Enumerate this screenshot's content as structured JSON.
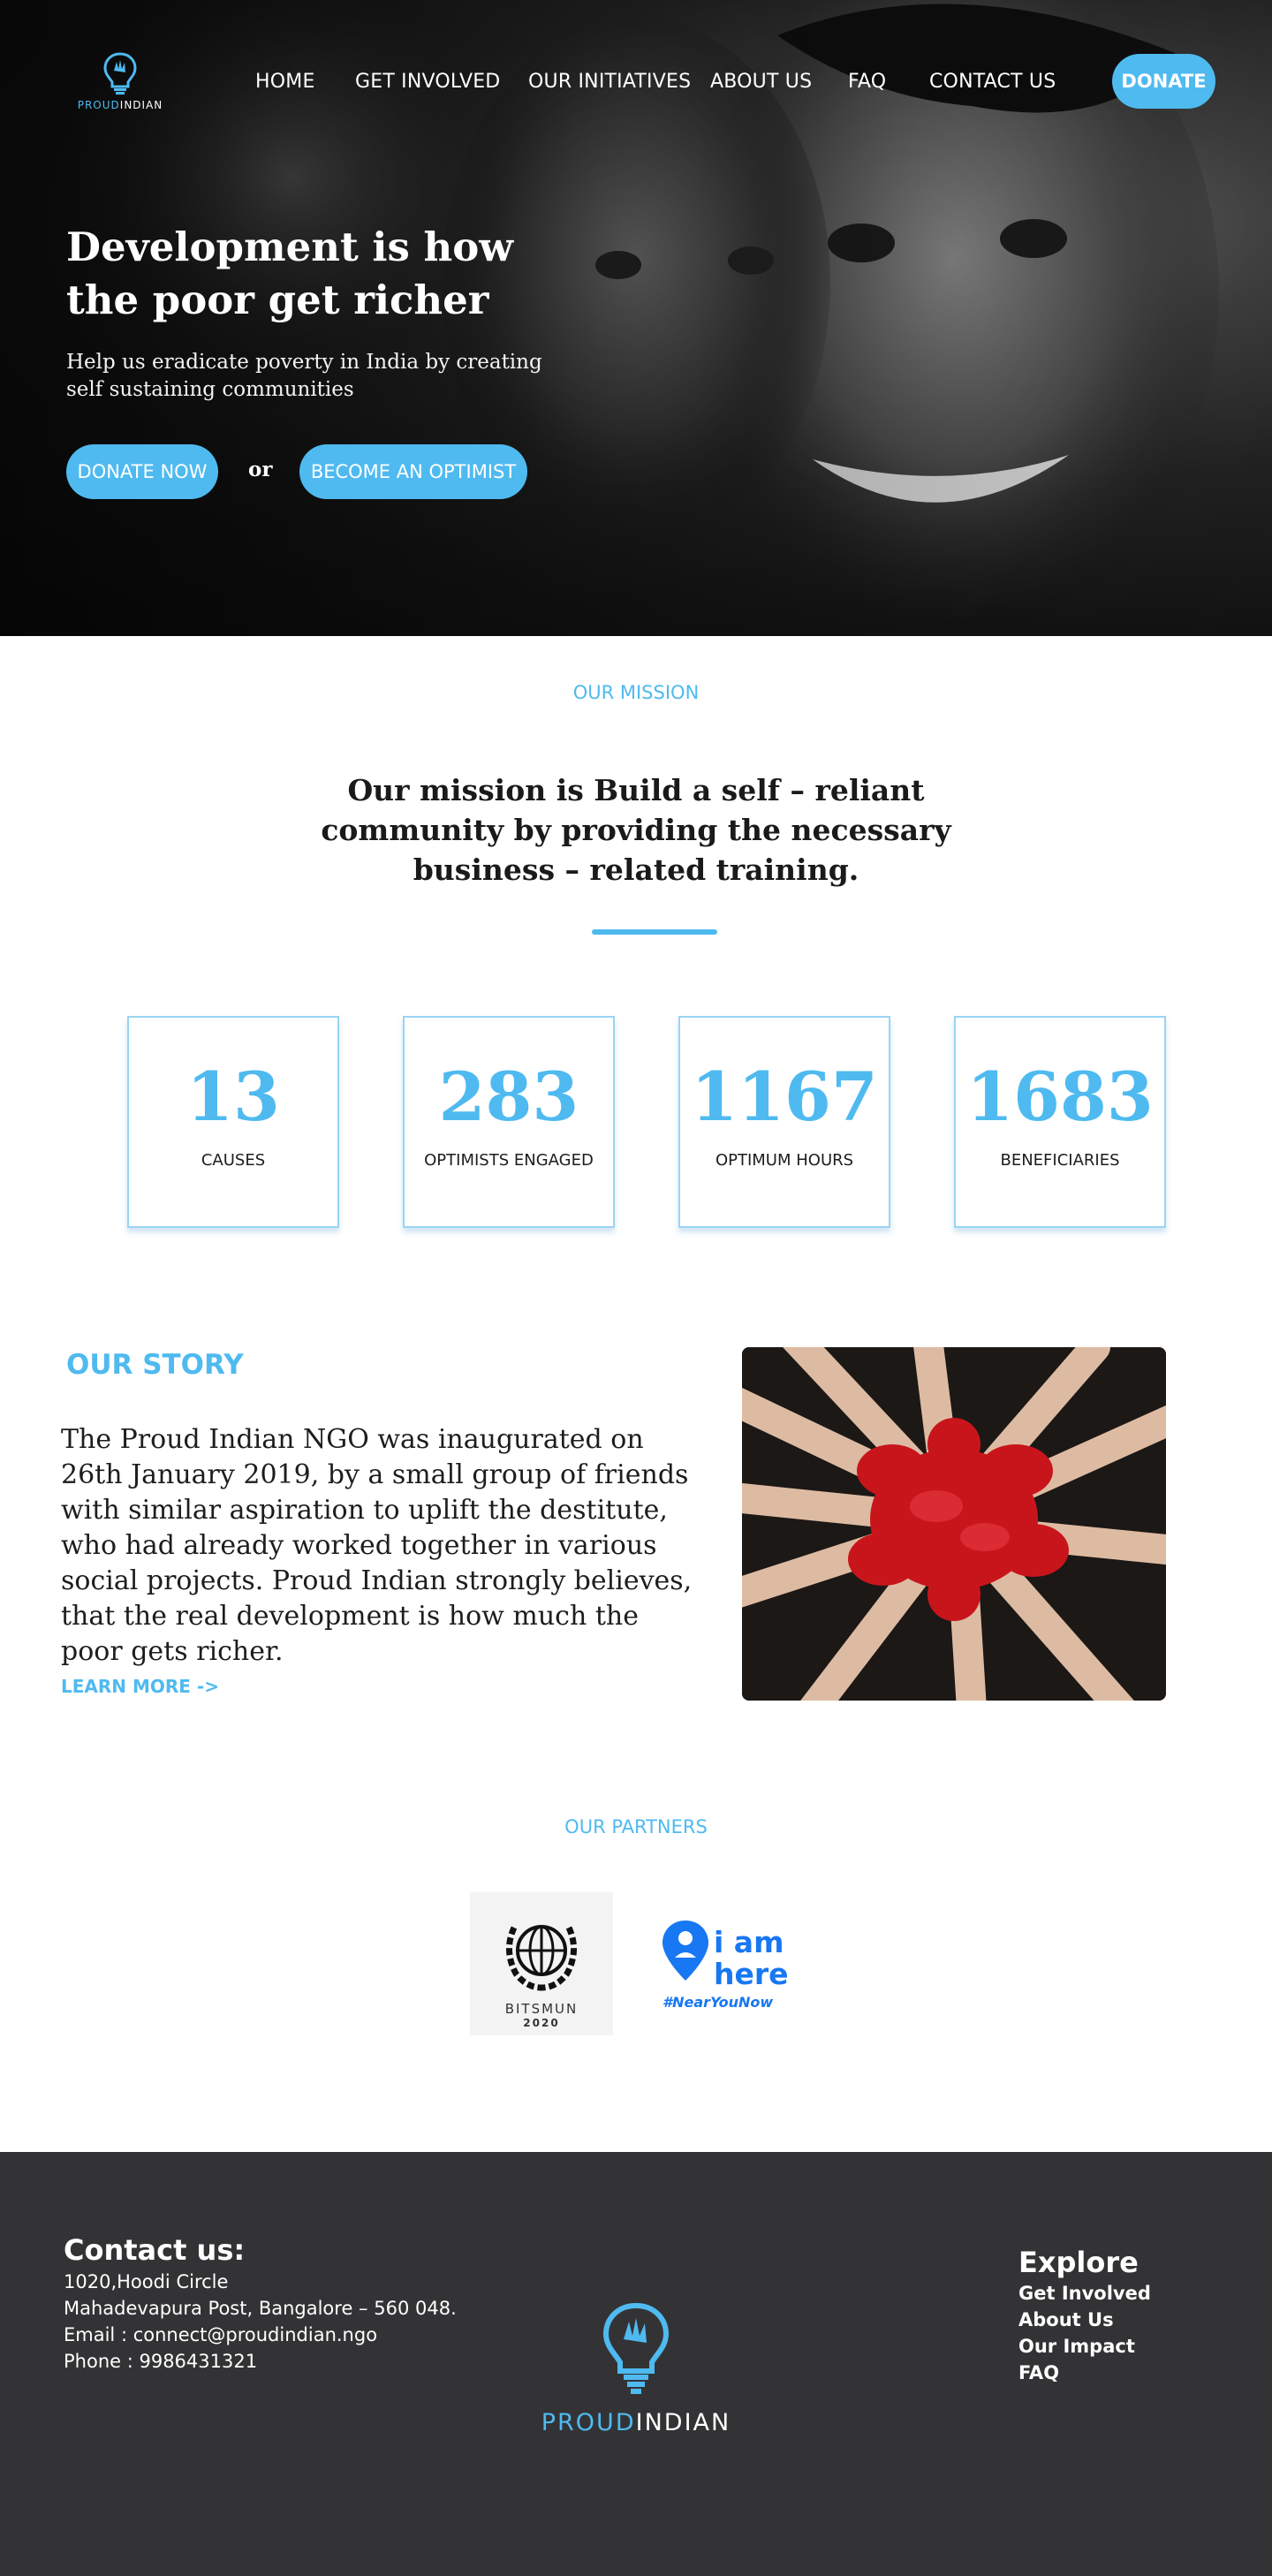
{
  "brand": {
    "logo_part1": "PROUD",
    "logo_part2": "INDIAN",
    "accent_color": "#4fbaf0",
    "footer_bg": "#333335",
    "logo_icon": "lightbulb-hand-icon"
  },
  "nav": {
    "items": [
      "HOME",
      "GET INVOLVED",
      "OUR INITIATIVES",
      "ABOUT US",
      "FAQ",
      "CONTACT US"
    ],
    "donate_label": "DONATE"
  },
  "hero": {
    "title": "Development is how the poor get richer",
    "subtitle": "Help us  eradicate poverty in India by creating self sustaining communities",
    "donate_now_label": "DONATE NOW",
    "or_label": "or",
    "optimist_label": "BECOME AN OPTIMIST"
  },
  "mission": {
    "label": "OUR MISSION",
    "text": "Our mission is Build a self – reliant community by providing the necessary business – related training."
  },
  "stats": [
    {
      "value": "13",
      "label": "CAUSES"
    },
    {
      "value": "283",
      "label": "OPTIMISTS ENGAGED"
    },
    {
      "value": "1167",
      "label": "OPTIMUM HOURS"
    },
    {
      "value": "1683",
      "label": "BENEFICIARIES"
    }
  ],
  "story": {
    "title": "OUR STORY",
    "text": "The Proud Indian NGO was inaugurated on 26th January 2019, by a small group of friends with similar aspiration to uplift the destitute, who had already worked together in various social projects. Proud Indian strongly believes, that the real development is how much the poor gets richer.",
    "learn_more": "LEARN MORE ->"
  },
  "partners": {
    "label": "OUR PARTNERS",
    "bitsmun_name": "BITSMUN",
    "bitsmun_year": "2020",
    "iamhere_line1": "i am",
    "iamhere_line2": "here",
    "iamhere_tag": "#NearYouNow"
  },
  "footer": {
    "contact_heading": "Contact us:",
    "address1": "1020,Hoodi Circle",
    "address2": "Mahadevapura Post, Bangalore – 560 048.",
    "email": "Email : connect@proudindian.ngo",
    "phone": "Phone : 9986431321",
    "explore_heading": "Explore",
    "links": [
      "Get Involved",
      "About Us",
      "Our Impact",
      "FAQ"
    ]
  }
}
